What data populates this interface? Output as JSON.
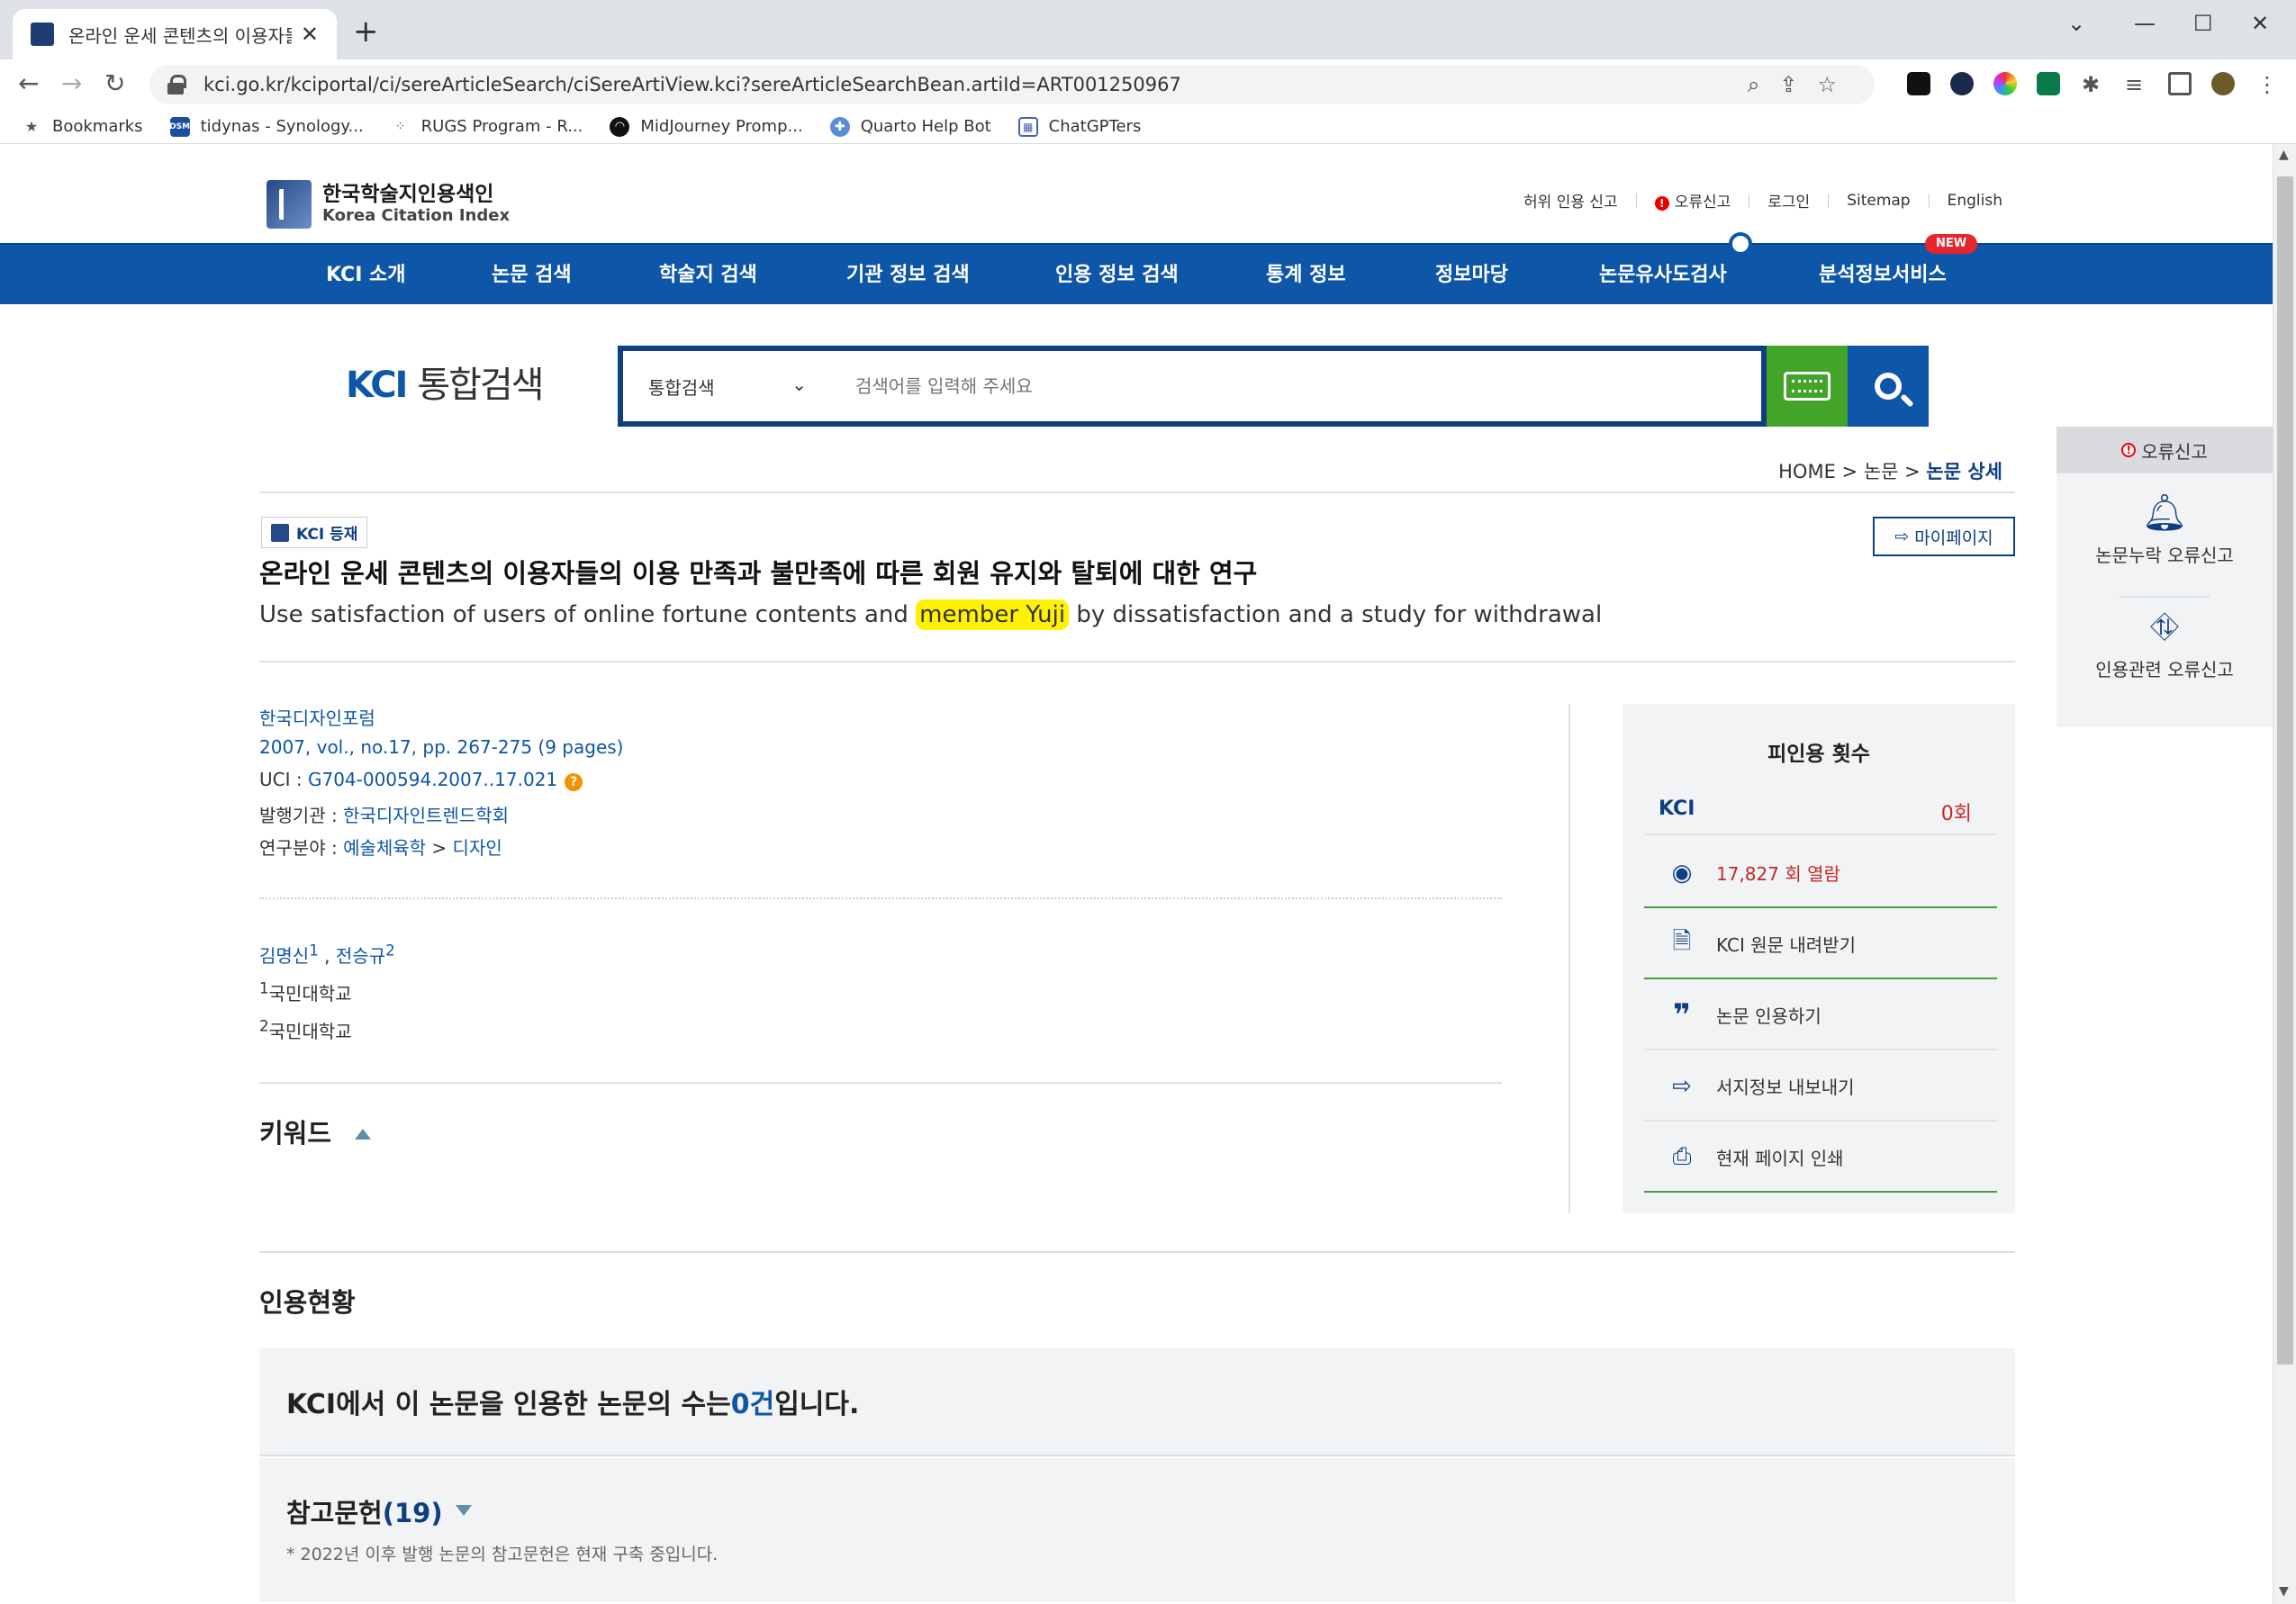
{
  "browser": {
    "tab_title": "온라인 운세 콘텐츠의 이용자들의",
    "url": "kci.go.kr/kciportal/ci/sereArticleSearch/ciSereArtiView.kci?sereArticleSearchBean.artiId=ART001250967",
    "bookmarks": [
      {
        "label": "Bookmarks",
        "icon": "star-icon"
      },
      {
        "label": "tidynas - Synology...",
        "icon": "dsm-icon"
      },
      {
        "label": "RUGS Program - R...",
        "icon": "rugs-icon"
      },
      {
        "label": "MidJourney Promp...",
        "icon": "midjourney-icon"
      },
      {
        "label": "Quarto Help Bot",
        "icon": "globe-icon"
      },
      {
        "label": "ChatGPTers",
        "icon": "chatgpters-icon"
      }
    ]
  },
  "header": {
    "logo_kr": "한국학술지인용색인",
    "logo_en": "Korea Citation Index",
    "util": [
      "허위 인용 신고",
      "오류신고",
      "로그인",
      "Sitemap",
      "English"
    ]
  },
  "gnb": {
    "items": [
      "KCI 소개",
      "논문 검색",
      "학술지 검색",
      "기관 정보 검색",
      "인용 정보 검색",
      "통계 정보",
      "정보마당",
      "논문유사도검사",
      "분석정보서비스"
    ],
    "new_badge": "NEW"
  },
  "search": {
    "logo_kci": "KCI",
    "logo_rest": "통합검색",
    "select_value": "통합검색",
    "placeholder": "검색어를 입력해 주세요"
  },
  "breadcrumb": {
    "home": "HOME",
    "sep1": " > ",
    "mid": "논문",
    "sep2": " > ",
    "current": "논문 상세"
  },
  "article": {
    "badge": "KCI 등재",
    "mypage": "마이페이지",
    "title_kr": "온라인 운세 콘텐츠의 이용자들의 이용 만족과 불만족에 따른 회원 유지와 탈퇴에 대한 연구",
    "title_en_before": "Use satisfaction of users of online fortune contents and ",
    "title_en_highlight": "member Yuji",
    "title_en_after": " by dissatisfaction and a study for withdrawal",
    "journal": "한국디자인포럼",
    "volume": "2007, vol., no.17, pp. 267-275 (9 pages)",
    "uci_label": "UCI : ",
    "uci_value": "G704-000594.2007..17.021",
    "publisher_label": "발행기관 : ",
    "publisher_value": "한국디자인트렌드학회",
    "field_label": "연구분야 : ",
    "field_value1": "예술체육학",
    "field_sep": " > ",
    "field_value2": "디자인",
    "authors": [
      {
        "name": "김명신",
        "sup": "1"
      },
      {
        "name": "전승규",
        "sup": "2"
      }
    ],
    "author_sep": " , ",
    "affiliations": [
      {
        "sup": "1",
        "name": "국민대학교"
      },
      {
        "sup": "2",
        "name": "국민대학교"
      }
    ],
    "keyword_heading": "키워드"
  },
  "citation_box": {
    "heading": "피인용 횟수",
    "kci_label": "KCI",
    "kci_count": "0회",
    "views": "17,827 회 열람",
    "download": "KCI 원문 내려받기",
    "cite": "논문 인용하기",
    "export": "서지정보 내보내기",
    "print": "현재 페이지 인쇄"
  },
  "side_panel": {
    "heading": "오류신고",
    "item1": "논문누락 오류신고",
    "item2": "인용관련 오류신고"
  },
  "citation_status": {
    "heading": "인용현황",
    "count_before": "KCI에서 이 논문을 인용한 논문의 수는 ",
    "count_value": "0건",
    "count_after": "입니다.",
    "refs_label": "참고문헌",
    "refs_count": "(19)",
    "refs_note": "* 2022년 이후 발행 논문의 참고문헌은 현재 구축 중입니다."
  }
}
